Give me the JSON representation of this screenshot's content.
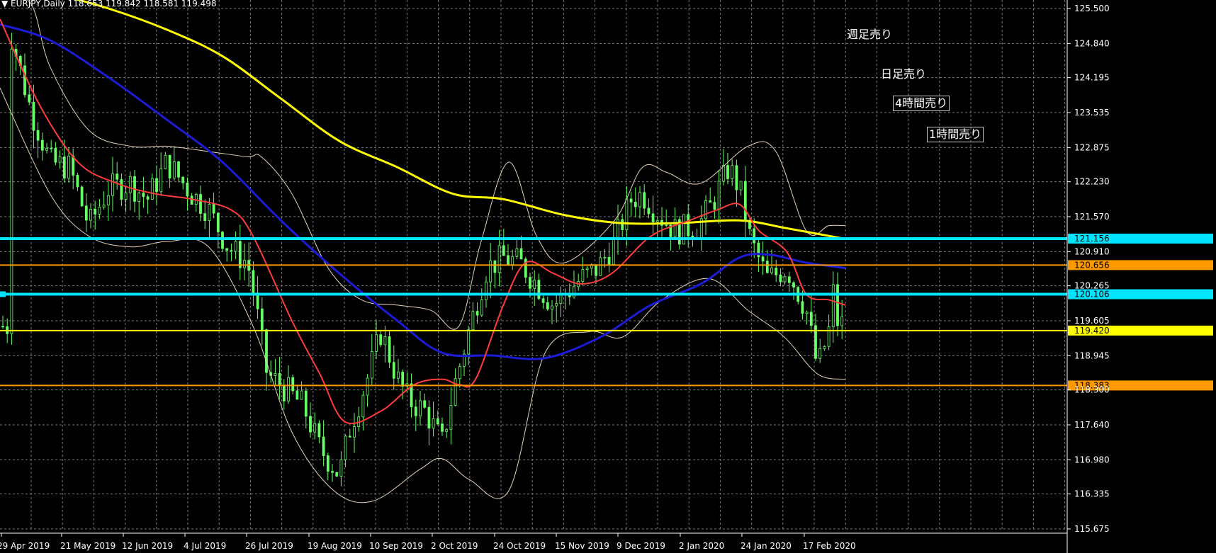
{
  "header": {
    "title": "EURJPY,Daily  118.653 119.842 118.581 119.498"
  },
  "annotations": [
    {
      "text": "週足売り",
      "boxed": false
    },
    {
      "text": "日足売り",
      "boxed": false
    },
    {
      "text": "4時間売り",
      "boxed": true
    },
    {
      "text": "1時間売り",
      "boxed": true
    }
  ],
  "colors": {
    "background": "#000000",
    "grid": "#7a7a7a",
    "candles": "#66ff66",
    "ma_fast": "#ff3b3b",
    "ma_mid": "#1c1cd6",
    "ma_slow": "#ffff00",
    "bollinger": "#e6d3b8",
    "cyan_level": "#00e5ff",
    "orange_level": "#ff9900",
    "yellow_level": "#ffff00"
  },
  "chart_data": {
    "type": "line",
    "symbol": "EURJPY",
    "timeframe": "Daily",
    "ohlc_last": {
      "open": 118.653,
      "high": 119.842,
      "low": 118.581,
      "close": 119.498
    },
    "ylim": [
      115.675,
      125.5
    ],
    "y_ticks": [
      "125.500",
      "124.840",
      "124.195",
      "123.535",
      "122.875",
      "122.230",
      "121.570",
      "120.910",
      "120.265",
      "119.605",
      "118.945",
      "118.300",
      "117.640",
      "116.980",
      "116.335",
      "115.675"
    ],
    "x_ticks": [
      "29 Apr 2019",
      "21 May 2019",
      "12 Jun 2019",
      "4 Jul 2019",
      "26 Jul 2019",
      "19 Aug 2019",
      "10 Sep 2019",
      "2 Oct 2019",
      "24 Oct 2019",
      "15 Nov 2019",
      "9 Dec 2019",
      "2 Jan 2020",
      "24 Jan 2020",
      "17 Feb 2020"
    ],
    "x_range": [
      "2019-04-26",
      "2020-02-24"
    ],
    "horizontal_levels": [
      {
        "value": 121.156,
        "label": "121.156",
        "color": "#00e5ff"
      },
      {
        "value": 120.656,
        "label": "120.656",
        "color": "#ff9900"
      },
      {
        "value": 120.106,
        "label": "120.106",
        "color": "#00e5ff"
      },
      {
        "value": 119.42,
        "label": "119.420",
        "color": "#ffff00"
      },
      {
        "value": 118.383,
        "label": "118.383",
        "color": "#ff9900"
      }
    ],
    "series": [
      {
        "key": "price",
        "points": [
          [
            "2019-04-29",
            125.2
          ],
          [
            "2019-05-07",
            123.6
          ],
          [
            "2019-05-14",
            122.6
          ],
          [
            "2019-05-21",
            122.5
          ],
          [
            "2019-05-28",
            121.4
          ],
          [
            "2019-06-04",
            122.1
          ],
          [
            "2019-06-12",
            122.2
          ],
          [
            "2019-06-18",
            121.9
          ],
          [
            "2019-06-25",
            122.6
          ],
          [
            "2019-07-04",
            122.0
          ],
          [
            "2019-07-10",
            121.7
          ],
          [
            "2019-07-17",
            121.0
          ],
          [
            "2019-07-24",
            120.7
          ],
          [
            "2019-07-26",
            120.2
          ],
          [
            "2019-07-31",
            118.6
          ],
          [
            "2019-08-07",
            118.3
          ],
          [
            "2019-08-13",
            118.0
          ],
          [
            "2019-08-19",
            117.2
          ],
          [
            "2019-08-26",
            116.7
          ],
          [
            "2019-08-30",
            117.6
          ],
          [
            "2019-09-05",
            118.5
          ],
          [
            "2019-09-10",
            119.4
          ],
          [
            "2019-09-16",
            118.5
          ],
          [
            "2019-09-20",
            118.1
          ],
          [
            "2019-09-26",
            117.9
          ],
          [
            "2019-10-02",
            117.3
          ],
          [
            "2019-10-06",
            118.3
          ],
          [
            "2019-10-12",
            119.5
          ],
          [
            "2019-10-18",
            120.6
          ],
          [
            "2019-10-24",
            120.8
          ],
          [
            "2019-10-30",
            120.7
          ],
          [
            "2019-11-05",
            120.3
          ],
          [
            "2019-11-11",
            119.9
          ],
          [
            "2019-11-15",
            120.1
          ],
          [
            "2019-11-21",
            120.4
          ],
          [
            "2019-11-27",
            120.6
          ],
          [
            "2019-12-03",
            121.1
          ],
          [
            "2019-12-09",
            121.9
          ],
          [
            "2019-12-13",
            122.0
          ],
          [
            "2019-12-19",
            121.6
          ],
          [
            "2019-12-25",
            121.3
          ],
          [
            "2020-01-02",
            121.4
          ],
          [
            "2020-01-07",
            121.8
          ],
          [
            "2020-01-13",
            122.5
          ],
          [
            "2020-01-17",
            122.1
          ],
          [
            "2020-01-21",
            121.1
          ],
          [
            "2020-01-27",
            120.4
          ],
          [
            "2020-02-03",
            120.6
          ],
          [
            "2020-02-10",
            119.8
          ],
          [
            "2020-02-14",
            118.7
          ],
          [
            "2020-02-18",
            119.4
          ],
          [
            "2020-02-20",
            120.3
          ],
          [
            "2020-02-21",
            119.6
          ],
          [
            "2020-02-24",
            119.5
          ]
        ]
      },
      {
        "key": "ma_fast",
        "points": [
          [
            "2019-04-26",
            125.3
          ],
          [
            "2019-05-10",
            123.7
          ],
          [
            "2019-05-24",
            122.6
          ],
          [
            "2019-06-07",
            122.2
          ],
          [
            "2019-06-21",
            122.0
          ],
          [
            "2019-07-04",
            121.9
          ],
          [
            "2019-07-18",
            121.7
          ],
          [
            "2019-07-26",
            121.2
          ],
          [
            "2019-08-09",
            119.6
          ],
          [
            "2019-08-19",
            118.6
          ],
          [
            "2019-08-28",
            117.7
          ],
          [
            "2019-09-10",
            117.9
          ],
          [
            "2019-09-22",
            118.4
          ],
          [
            "2019-10-02",
            118.5
          ],
          [
            "2019-10-08",
            118.4
          ],
          [
            "2019-10-14",
            118.5
          ],
          [
            "2019-10-24",
            119.9
          ],
          [
            "2019-11-01",
            120.7
          ],
          [
            "2019-11-11",
            120.5
          ],
          [
            "2019-11-21",
            120.3
          ],
          [
            "2019-12-02",
            120.5
          ],
          [
            "2019-12-16",
            121.2
          ],
          [
            "2019-12-30",
            121.5
          ],
          [
            "2020-01-09",
            121.7
          ],
          [
            "2020-01-17",
            121.8
          ],
          [
            "2020-01-24",
            121.3
          ],
          [
            "2020-02-03",
            120.9
          ],
          [
            "2020-02-10",
            120.1
          ],
          [
            "2020-02-18",
            120.0
          ],
          [
            "2020-02-24",
            119.9
          ]
        ]
      },
      {
        "key": "ma_mid",
        "points": [
          [
            "2019-04-26",
            125.2
          ],
          [
            "2019-05-14",
            124.9
          ],
          [
            "2019-06-04",
            124.2
          ],
          [
            "2019-06-25",
            123.4
          ],
          [
            "2019-07-15",
            122.6
          ],
          [
            "2019-08-05",
            121.5
          ],
          [
            "2019-08-26",
            120.5
          ],
          [
            "2019-09-16",
            119.6
          ],
          [
            "2019-10-02",
            119.0
          ],
          [
            "2019-10-20",
            118.95
          ],
          [
            "2019-11-08",
            118.9
          ],
          [
            "2019-11-28",
            119.3
          ],
          [
            "2019-12-16",
            119.9
          ],
          [
            "2020-01-03",
            120.3
          ],
          [
            "2020-01-17",
            120.8
          ],
          [
            "2020-01-28",
            120.85
          ],
          [
            "2020-02-10",
            120.7
          ],
          [
            "2020-02-24",
            120.6
          ]
        ]
      },
      {
        "key": "ma_slow",
        "points": [
          [
            "2019-04-26",
            126.0
          ],
          [
            "2019-05-14",
            125.8
          ],
          [
            "2019-06-04",
            125.5
          ],
          [
            "2019-06-25",
            125.1
          ],
          [
            "2019-07-15",
            124.6
          ],
          [
            "2019-08-05",
            123.8
          ],
          [
            "2019-08-26",
            123.0
          ],
          [
            "2019-09-16",
            122.5
          ],
          [
            "2019-10-06",
            122.0
          ],
          [
            "2019-10-24",
            121.9
          ],
          [
            "2019-11-15",
            121.6
          ],
          [
            "2019-12-05",
            121.45
          ],
          [
            "2019-12-26",
            121.45
          ],
          [
            "2020-01-17",
            121.5
          ],
          [
            "2020-02-03",
            121.35
          ],
          [
            "2020-02-24",
            121.15
          ]
        ]
      },
      {
        "key": "bb_upper",
        "points": [
          [
            "2019-04-26",
            125.7
          ],
          [
            "2019-05-07",
            125.6
          ],
          [
            "2019-05-14",
            124.4
          ],
          [
            "2019-05-28",
            123.2
          ],
          [
            "2019-06-12",
            122.9
          ],
          [
            "2019-06-25",
            122.9
          ],
          [
            "2019-07-10",
            122.8
          ],
          [
            "2019-07-24",
            122.7
          ],
          [
            "2019-07-29",
            122.7
          ],
          [
            "2019-08-09",
            122.0
          ],
          [
            "2019-08-22",
            120.6
          ],
          [
            "2019-09-03",
            120.0
          ],
          [
            "2019-09-16",
            119.9
          ],
          [
            "2019-09-28",
            119.8
          ],
          [
            "2019-10-08",
            119.5
          ],
          [
            "2019-10-16",
            121.1
          ],
          [
            "2019-10-26",
            122.6
          ],
          [
            "2019-11-05",
            121.2
          ],
          [
            "2019-11-15",
            120.7
          ],
          [
            "2019-12-03",
            121.5
          ],
          [
            "2019-12-13",
            122.5
          ],
          [
            "2019-12-22",
            122.4
          ],
          [
            "2020-01-03",
            122.2
          ],
          [
            "2020-01-20",
            122.9
          ],
          [
            "2020-01-30",
            122.8
          ],
          [
            "2020-02-10",
            121.3
          ],
          [
            "2020-02-18",
            121.4
          ],
          [
            "2020-02-24",
            121.4
          ]
        ]
      },
      {
        "key": "bb_lower",
        "points": [
          [
            "2019-04-26",
            124.0
          ],
          [
            "2019-05-14",
            122.0
          ],
          [
            "2019-05-28",
            121.2
          ],
          [
            "2019-06-12",
            121.0
          ],
          [
            "2019-06-25",
            121.1
          ],
          [
            "2019-07-10",
            121.0
          ],
          [
            "2019-07-26",
            119.5
          ],
          [
            "2019-08-09",
            117.5
          ],
          [
            "2019-08-24",
            116.4
          ],
          [
            "2019-09-07",
            116.2
          ],
          [
            "2019-09-24",
            116.8
          ],
          [
            "2019-10-02",
            117.0
          ],
          [
            "2019-10-12",
            116.6
          ],
          [
            "2019-10-26",
            116.4
          ],
          [
            "2019-11-08",
            119.0
          ],
          [
            "2019-11-24",
            119.4
          ],
          [
            "2019-12-06",
            119.3
          ],
          [
            "2019-12-20",
            120.0
          ],
          [
            "2020-01-06",
            120.4
          ],
          [
            "2020-01-20",
            119.8
          ],
          [
            "2020-02-02",
            119.3
          ],
          [
            "2020-02-14",
            118.6
          ],
          [
            "2020-02-24",
            118.5
          ]
        ]
      }
    ]
  }
}
